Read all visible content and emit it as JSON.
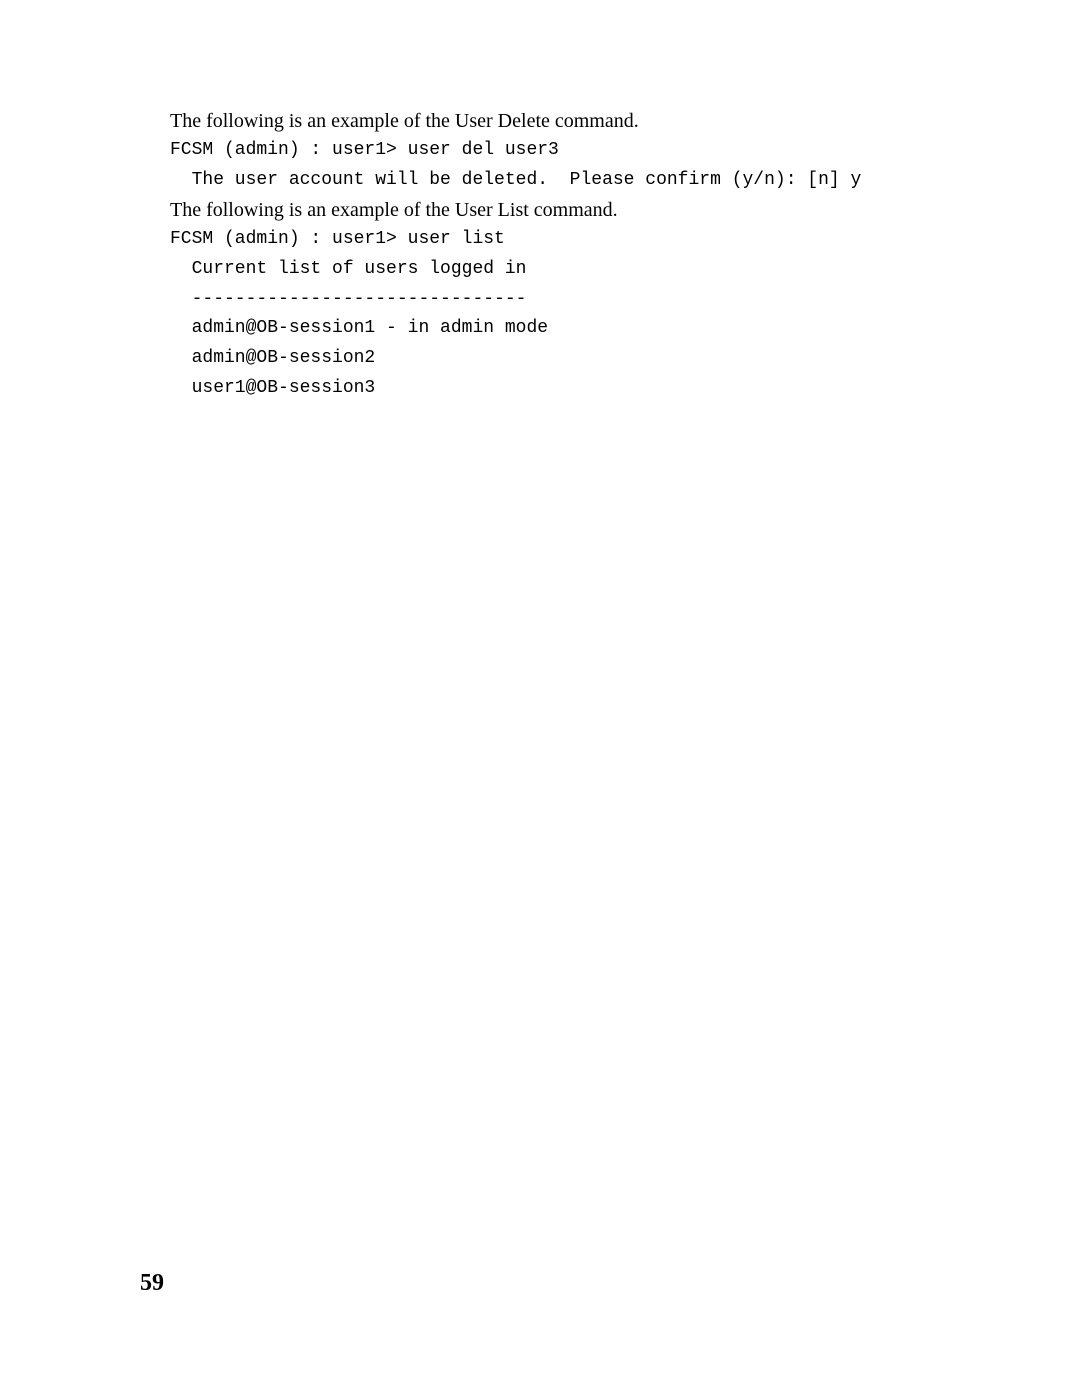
{
  "lines": [
    {
      "kind": "prose",
      "text": "The following is an example of the User Delete command."
    },
    {
      "kind": "code",
      "text": "FCSM (admin) : user1> user del user3"
    },
    {
      "kind": "code",
      "text": "  The user account will be deleted.  Please confirm (y/n): [n] y"
    },
    {
      "kind": "prose",
      "text": "The following is an example of the User List command."
    },
    {
      "kind": "code",
      "text": "FCSM (admin) : user1> user list"
    },
    {
      "kind": "code",
      "text": "  Current list of users logged in"
    },
    {
      "kind": "code",
      "text": "  -------------------------------"
    },
    {
      "kind": "code",
      "text": "  admin@OB-session1 - in admin mode"
    },
    {
      "kind": "code",
      "text": "  admin@OB-session2"
    },
    {
      "kind": "code",
      "text": "  user1@OB-session3"
    }
  ],
  "page_number": "59"
}
